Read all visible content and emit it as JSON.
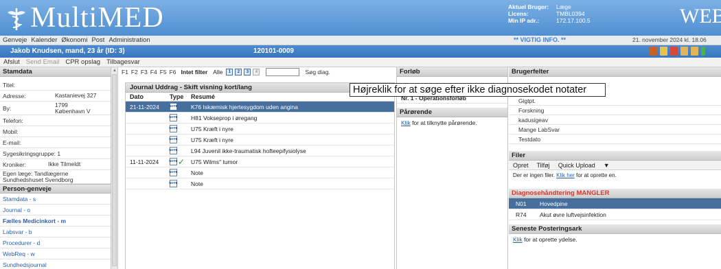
{
  "header": {
    "logo_text": "MultiMED",
    "web_text": "WEB",
    "user_info": [
      {
        "label": "Aktuel Bruger:",
        "value": "Læge"
      },
      {
        "label": "Licens:",
        "value": "TMBL0394"
      },
      {
        "label": "Min IP adr.:",
        "value": "172.17.100.5"
      }
    ]
  },
  "menu": {
    "items": [
      "Genveje",
      "Kalender",
      "Økonomi",
      "Post",
      "Administration"
    ],
    "important": "** VIGTIG INFO. **",
    "datetime": "21. november 2024 kl. 18.06"
  },
  "patient": {
    "name": "Jakob Knudsen, mand, 23 år (ID: 3)",
    "id": "120101-0009"
  },
  "toolbar": {
    "items": [
      "Afslut",
      "Send Email",
      "CPR opslag",
      "Tilbagesvar"
    ]
  },
  "stamdata": {
    "title": "Stamdata",
    "fields": [
      {
        "label": "Titel:",
        "value": ""
      },
      {
        "label": "Adresse:",
        "value": "Kastanievej 327"
      },
      {
        "label": "By:",
        "value": "1799\nKøbenhavn V"
      },
      {
        "label": "Telefon:",
        "value": ""
      },
      {
        "label": "Mobil:",
        "value": ""
      },
      {
        "label": "E-mail:",
        "value": ""
      },
      {
        "label": "Sygesikringsgruppe: 1",
        "value": ""
      },
      {
        "label": "Kroniker:",
        "value": "Ikke Tilmeldt"
      }
    ],
    "egen_laege": "Egen læge: Tandlægerne Sundhedshuset Svendborg"
  },
  "person_genveje": {
    "title": "Person-genveje",
    "items": [
      "Stamdata - s",
      "Journal - o",
      "Fælles Medicinkort - m",
      "Labsvar - b",
      "Procedurer - d",
      "WebReq - w",
      "Sundhedsjournal"
    ]
  },
  "center_toolbar": {
    "fkeys": [
      "F1",
      "F2",
      "F3",
      "F4",
      "F5",
      "F6"
    ],
    "intet_filter": "Intet filter",
    "alle": "Alle",
    "search_value": "",
    "search_label": "Søg diag."
  },
  "journal": {
    "title": "Journal Uddrag - Skift visning kort/lang",
    "columns": [
      "Dato",
      "Type",
      "Resumé"
    ],
    "rows": [
      {
        "date": "21-11-2024",
        "type": "NOTE",
        "resume": "K76 Iskæmisk hjertesygdom uden angina",
        "selected": true,
        "check": false
      },
      {
        "date": "",
        "type": "NOTE",
        "resume": "H81 Vokseprop i øregang",
        "selected": false,
        "check": false
      },
      {
        "date": "",
        "type": "NOTE",
        "resume": "U75 Kræft i nyre",
        "selected": false,
        "check": false
      },
      {
        "date": "",
        "type": "NOTE",
        "resume": "U75 Kræft i nyre",
        "selected": false,
        "check": false
      },
      {
        "date": "",
        "type": "NOTE",
        "resume": "L94 Juvenil ikke-traumatisk hofteepifysiolyse",
        "selected": false,
        "check": false
      },
      {
        "date": "11-11-2024",
        "type": "NOTE",
        "resume": "U75 Wilms\" tumor",
        "selected": false,
        "check": true
      },
      {
        "date": "",
        "type": "NOTE",
        "resume": "Note",
        "selected": false,
        "check": false
      },
      {
        "date": "",
        "type": "NOTE",
        "resume": "Note",
        "selected": false,
        "check": false
      }
    ]
  },
  "forloeb": {
    "title": "Forløb",
    "item": "Nr. 1 - Operationsforløb",
    "paarorende_title": "Pårørende",
    "paarorende_link": "Klik",
    "paarorende_text": " for at tilknytte pårørende."
  },
  "brugerfelter": {
    "title": "Brugerfelter",
    "items": [
      "Gigtpt.",
      "Forskning",
      "kadusigeav",
      "Mange LabSvar",
      "Testdato"
    ]
  },
  "filer": {
    "title": "Filer",
    "actions": [
      "Opret",
      "Tilføj",
      "Quick Upload",
      "▼"
    ],
    "empty_prefix": "Der er ingen filer. ",
    "empty_link": "Klik her",
    "empty_suffix": " for at oprette en."
  },
  "diagnose": {
    "title": "Diagnosehåndtering MANGLER",
    "rows": [
      {
        "code": "N01",
        "text": "Hovedpine",
        "selected": true
      },
      {
        "code": "R74",
        "text": "Akut øvre luftvejsinfektion",
        "selected": false
      }
    ]
  },
  "posteringsark": {
    "title": "Seneste Posteringsark",
    "link": "Klik",
    "text": " for at oprette ydelse."
  },
  "tooltip": {
    "text": "Højreklik for at søge efter ikke diagnosekodet notater"
  },
  "colors": {
    "header_blue": "#5b98d8",
    "patient_bar": "#3f7fc6",
    "selected_row": "#476f9e",
    "link_blue": "#2c5fa8",
    "diag_red": "#d9362e"
  }
}
